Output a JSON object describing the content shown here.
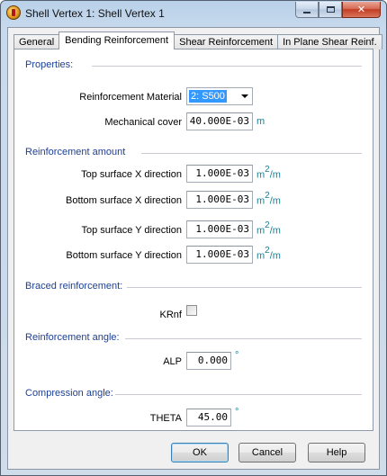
{
  "window": {
    "title": "Shell Vertex 1: Shell Vertex 1"
  },
  "tabs": [
    "General",
    "Bending Reinforcement",
    "Shear Reinforcement",
    "In Plane Shear Reinf."
  ],
  "active_tab": "Bending Reinforcement",
  "properties": {
    "header": "Properties:",
    "material_label": "Reinforcement Material",
    "material_value": "2: S500",
    "cover_label": "Mechanical cover",
    "cover_value": "40.000E-03",
    "cover_unit": "m"
  },
  "reinforcement_amount": {
    "header": "Reinforcement amount",
    "unit_base": "m",
    "unit_exp": "2",
    "unit_suffix": "/m",
    "rows": [
      {
        "label": "Top surface X direction",
        "value": "1.000E-03"
      },
      {
        "label": "Bottom surface X direction",
        "value": "1.000E-03"
      },
      {
        "label": "Top surface Y direction",
        "value": "1.000E-03"
      },
      {
        "label": "Bottom surface Y direction",
        "value": "1.000E-03"
      }
    ]
  },
  "braced": {
    "header": "Braced reinforcement:",
    "label": "KRnf",
    "checked": false
  },
  "angle": {
    "header": "Reinforcement angle:",
    "label": "ALP",
    "value": "0.000",
    "unit": "°"
  },
  "compression": {
    "header": "Compression angle:",
    "label": "THETA",
    "value": "45.00",
    "unit": "°"
  },
  "buttons": {
    "ok": "OK",
    "cancel": "Cancel",
    "help": "Help"
  },
  "colors": {
    "accent": "#1c3f95",
    "unit": "#1a7f95",
    "selection": "#3399ff"
  }
}
